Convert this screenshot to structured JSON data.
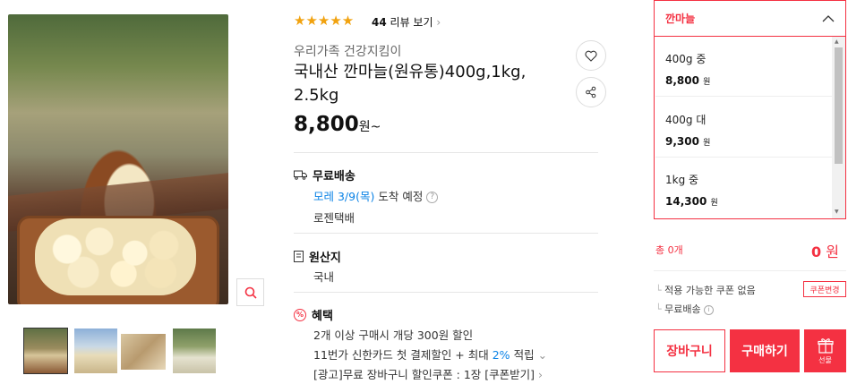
{
  "rating": {
    "stars": "★★★★★",
    "review_count": "44",
    "review_label": "리뷰 보기"
  },
  "product": {
    "brand": "우리가족 건강지킴이",
    "title": "국내산 깐마늘(원유통)400g,1kg, 2.5kg",
    "price": "8,800",
    "price_suffix": "원~"
  },
  "shipping": {
    "title": "무료배송",
    "date_highlight": "모레 3/9(목)",
    "date_suffix": "도착 예정",
    "courier": "로젠택배"
  },
  "origin": {
    "title": "원산지",
    "value": "국내"
  },
  "benefit": {
    "title": "혜택",
    "line1": "2개 이상 구매시 개당 300원 할인",
    "line2_prefix": "11번가 신한카드 첫 결제할인 + 최대",
    "line2_pct": "2%",
    "line2_suffix": "적립",
    "line3": "[광고]무료 장바구니 할인쿠폰 : 1장 [쿠폰받기]"
  },
  "option_panel": {
    "header": "깐마늘",
    "options": [
      {
        "name": "400g 중",
        "price": "8,800",
        "unit": "원"
      },
      {
        "name": "400g 대",
        "price": "9,300",
        "unit": "원"
      },
      {
        "name": "1kg 중",
        "price": "14,300",
        "unit": "원"
      }
    ]
  },
  "summary": {
    "total_label": "총 0개",
    "total_value": "0",
    "total_unit": "원",
    "coupon_text": "적용 가능한 쿠폰 없음",
    "coupon_button": "쿠폰변경",
    "delivery_text": "무료배송"
  },
  "actions": {
    "cart": "장바구니",
    "buy": "구매하기",
    "gift": "선물"
  },
  "colors": {
    "accent": "#f43142",
    "link": "#0b83e6",
    "star": "#f1a20f"
  }
}
